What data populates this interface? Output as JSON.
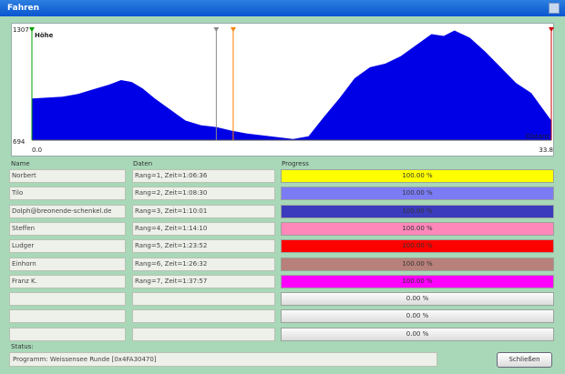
{
  "window": {
    "title": "Fahren"
  },
  "chart_data": {
    "type": "area",
    "ylabel": "Höhe",
    "xlabel": "Distanz",
    "xlim": [
      0.0,
      33.8
    ],
    "ylim": [
      694,
      1307
    ],
    "y_min_label": "694",
    "y_max_label": "1307",
    "x_min_label": "0.0",
    "x_max_label": "33.8",
    "fill_color": "#0000e6",
    "x": [
      0.0,
      1.0,
      2.0,
      3.0,
      4.0,
      5.0,
      5.8,
      6.5,
      7.2,
      8.0,
      9.0,
      10.0,
      11.0,
      12.0,
      13.0,
      14.0,
      15.0,
      16.0,
      17.0,
      18.0,
      19.0,
      20.0,
      21.0,
      22.0,
      23.0,
      24.0,
      25.0,
      26.0,
      26.8,
      27.5,
      28.5,
      29.5,
      30.5,
      31.5,
      32.5,
      33.8
    ],
    "y": [
      920,
      925,
      930,
      945,
      970,
      995,
      1020,
      1010,
      975,
      920,
      860,
      800,
      775,
      765,
      745,
      730,
      720,
      710,
      700,
      715,
      820,
      920,
      1030,
      1090,
      1110,
      1150,
      1210,
      1270,
      1260,
      1290,
      1250,
      1175,
      1090,
      1005,
      950,
      800
    ],
    "markers": [
      {
        "x": 0.0,
        "color": "#00a000"
      },
      {
        "x": 12.0,
        "color": "#888888"
      },
      {
        "x": 13.1,
        "color": "#ff7f00"
      },
      {
        "x": 33.8,
        "color": "#cc0000"
      }
    ]
  },
  "columns": {
    "name": "Name",
    "data": "Daten",
    "progress": "Progress"
  },
  "rows": [
    {
      "name": "Norbert",
      "data": "Rang=1, Zeit=1:06:36",
      "progress": "100.00 %",
      "fraction": 1.0,
      "color": "#ffff00"
    },
    {
      "name": "Tilo",
      "data": "Rang=2, Zeit=1:08:30",
      "progress": "100.00 %",
      "fraction": 1.0,
      "color": "#7b7bf4"
    },
    {
      "name": "Dolph@breonende-schenkel.de",
      "data": "Rang=3, Zeit=1:10:01",
      "progress": "100.00 %",
      "fraction": 1.0,
      "color": "#3b3bbd"
    },
    {
      "name": "Steffen",
      "data": "Rang=4, Zeit=1:14:10",
      "progress": "100.00 %",
      "fraction": 1.0,
      "color": "#ff88bb"
    },
    {
      "name": "Ludger",
      "data": "Rang=5, Zeit=1:23:52",
      "progress": "100.00 %",
      "fraction": 1.0,
      "color": "#ff0000"
    },
    {
      "name": "Einhorn",
      "data": "Rang=6, Zeit=1:26:32",
      "progress": "100.00 %",
      "fraction": 1.0,
      "color": "#b8807a"
    },
    {
      "name": "Franz K.",
      "data": "Rang=7, Zeit=1:37:57",
      "progress": "100.00 %",
      "fraction": 1.0,
      "color": "#ff00ff"
    },
    {
      "name": "",
      "data": "",
      "progress": "0.00 %",
      "fraction": 0.0,
      "color": "#cccccc"
    },
    {
      "name": "",
      "data": "",
      "progress": "0.00 %",
      "fraction": 0.0,
      "color": "#cccccc"
    },
    {
      "name": "",
      "data": "",
      "progress": "0.00 %",
      "fraction": 0.0,
      "color": "#cccccc"
    }
  ],
  "status": {
    "label": "Status:",
    "text": "Programm: Weissensee Runde [0x4FA30470]"
  },
  "buttons": {
    "close": "Schließen"
  }
}
